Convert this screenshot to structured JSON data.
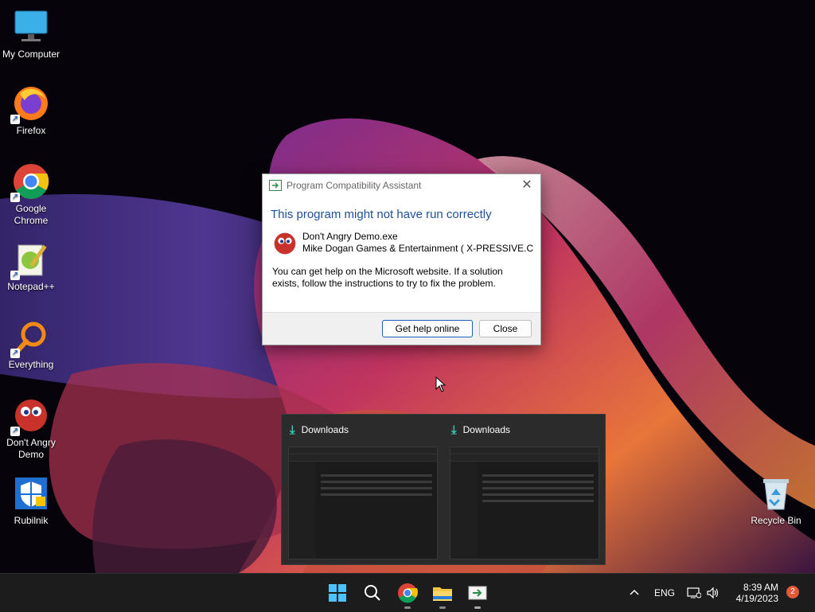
{
  "desktop": {
    "icons": [
      {
        "label": "My Computer"
      },
      {
        "label": "Firefox"
      },
      {
        "label": "Google Chrome"
      },
      {
        "label": "Notepad++"
      },
      {
        "label": "Everything"
      },
      {
        "label": "Don't Angry Demo"
      },
      {
        "label": "Rubilnik"
      },
      {
        "label": "Recycle Bin"
      }
    ]
  },
  "dialog": {
    "title": "Program Compatibility Assistant",
    "close_glyph": "✕",
    "heading": "This program might not have run correctly",
    "program_name": "Don't Angry Demo.exe",
    "publisher": "Mike Dogan Games & Entertainment ( X-PRESSIVE.COM",
    "body_line1": "You can get help on the Microsoft website.  If a solution",
    "body_line2": "exists, follow the instructions to try to fix the problem.",
    "btn_help": "Get help online",
    "btn_close": "Close"
  },
  "preview": {
    "items": [
      {
        "title": "Downloads"
      },
      {
        "title": "Downloads"
      }
    ]
  },
  "taskbar": {
    "language": "ENG",
    "time": "8:39 AM",
    "date": "4/19/2023",
    "notification_count": "2",
    "chevron": "^"
  },
  "colors": {
    "accent": "#1f5dbe",
    "heading": "#1f4e9c",
    "taskbar": "#1c1c1c"
  },
  "icons": [
    "windows-start-icon",
    "search-icon",
    "chrome-icon",
    "file-explorer-icon",
    "compat-assistant-icon",
    "network-icon",
    "volume-icon"
  ]
}
